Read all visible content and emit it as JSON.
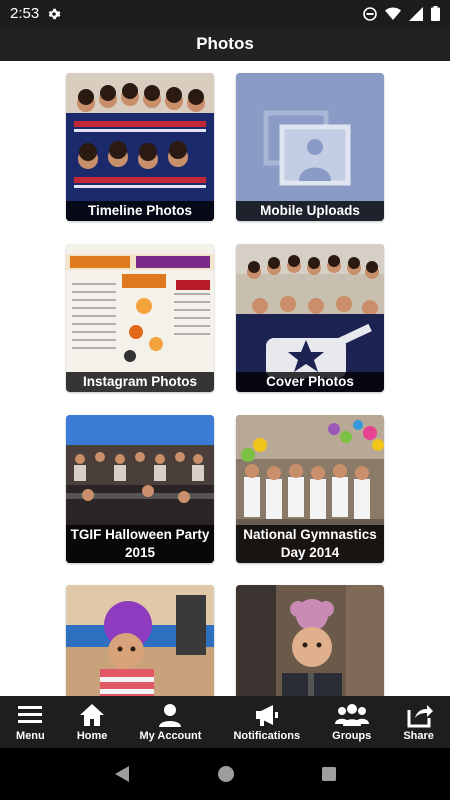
{
  "status": {
    "time": "2:53"
  },
  "header": {
    "title": "Photos"
  },
  "albums": [
    {
      "title": "Timeline Photos"
    },
    {
      "title": "Mobile Uploads"
    },
    {
      "title": "Instagram Photos"
    },
    {
      "title": "Cover Photos"
    },
    {
      "title": "TGIF Halloween Party 2015"
    },
    {
      "title": "National Gymnastics Day 2014"
    },
    {
      "title": ""
    },
    {
      "title": ""
    }
  ],
  "bottom_nav": [
    {
      "label": "Menu",
      "icon": "menu-icon"
    },
    {
      "label": "Home",
      "icon": "home-icon"
    },
    {
      "label": "My Account",
      "icon": "user-icon"
    },
    {
      "label": "Notifications",
      "icon": "megaphone-icon"
    },
    {
      "label": "Groups",
      "icon": "groups-icon"
    },
    {
      "label": "Share",
      "icon": "share-icon"
    }
  ],
  "colors": {
    "header_bg": "#222222",
    "nav_bg": "#1e1e1e",
    "placeholder_tile": "#8a9cc6"
  }
}
